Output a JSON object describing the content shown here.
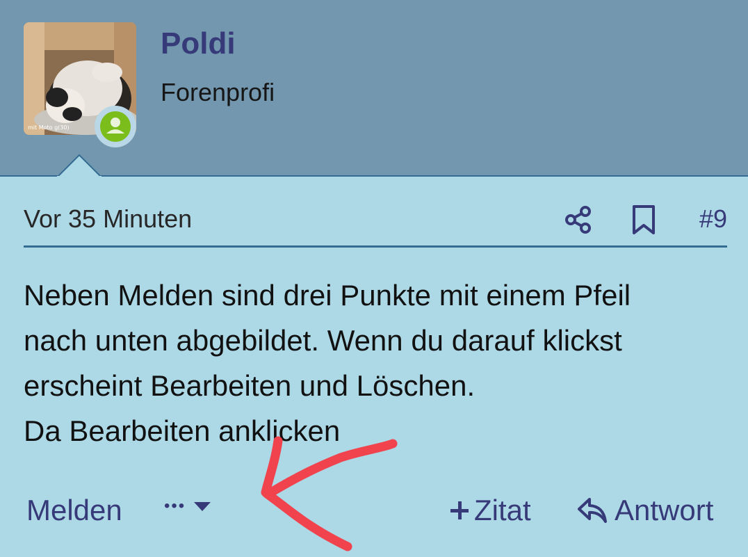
{
  "user": {
    "name": "Poldi",
    "title": "Forenprofi",
    "avatar_watermark": "mit Moto g(30)",
    "status": "online"
  },
  "post": {
    "time": "Vor 35 Minuten",
    "number": "#9",
    "lines": [
      "Neben Melden sind drei Punkte mit einem Pfeil",
      "nach unten abgebildet. Wenn du darauf klickst",
      "erscheint Bearbeiten und Löschen.",
      "Da Bearbeiten anklicken"
    ]
  },
  "actions": {
    "report_label": "Melden",
    "more_label": "•••",
    "quote_label": "Zitat",
    "reply_label": "Antwort"
  },
  "icons": {
    "share": "share-icon",
    "bookmark": "bookmark-icon",
    "more_caret": "caret-down-icon",
    "quote_plus": "plus-icon",
    "reply": "reply-arrow-icon",
    "status": "user-online-icon"
  },
  "colors": {
    "header_bg": "#7397ae",
    "body_bg": "#add8e6",
    "link": "#373a78",
    "divider": "#336b92",
    "status_green": "#7bbd1a",
    "annotation_red": "#f0434e"
  }
}
